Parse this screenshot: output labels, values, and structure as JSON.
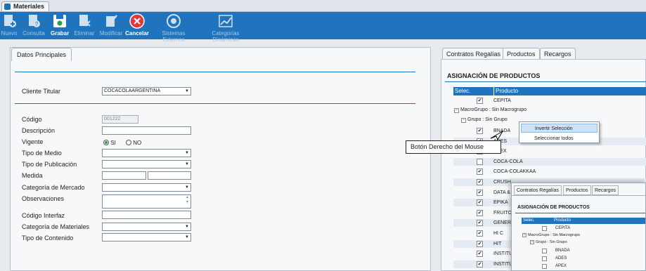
{
  "window": {
    "tab_title": "Materiales"
  },
  "toolbar": [
    {
      "label": "Nuevo",
      "icon": "new-doc-icon",
      "enabled": false
    },
    {
      "label": "Consulta",
      "icon": "query-doc-icon",
      "enabled": false
    },
    {
      "label": "Grabar",
      "icon": "save-icon",
      "enabled": true
    },
    {
      "label": "Eliminar",
      "icon": "delete-doc-icon",
      "enabled": false
    },
    {
      "label": "Modificar",
      "icon": "edit-doc-icon",
      "enabled": false
    },
    {
      "label": "Cancelar",
      "icon": "cancel-icon",
      "enabled": true
    },
    {
      "label": "Sistemas Externos",
      "icon": "external-systems-icon",
      "enabled": false
    },
    {
      "label": "Categorías Dinámicas",
      "icon": "chart-line-icon",
      "enabled": false
    }
  ],
  "left": {
    "tab": "Datos Principales",
    "cliente_label": "Cliente Titular",
    "cliente_value": "COCACOLAARGENTINA",
    "fields": {
      "codigo": {
        "label": "Código",
        "value": "001222"
      },
      "descripcion": {
        "label": "Descripción"
      },
      "vigente": {
        "label": "Vigente",
        "si": "SI",
        "no": "NO"
      },
      "tipo_medio": {
        "label": "Tipo de Medio"
      },
      "tipo_publicacion": {
        "label": "Tipo de Publicación"
      },
      "medida": {
        "label": "Medida"
      },
      "categoria_mercado": {
        "label": "Categoría de Mercado"
      },
      "observaciones": {
        "label": "Observaciones"
      },
      "codigo_interfaz": {
        "label": "Código Interfaz"
      },
      "categoria_materiales": {
        "label": "Categoría de Materiales"
      },
      "tipo_contenido": {
        "label": "Tipo de Contenido"
      }
    }
  },
  "right": {
    "tabs": [
      "Contratos Regalías",
      "Productos",
      "Recargos"
    ],
    "section_title": "ASIGNACIÓN DE PRODUCTOS",
    "col_selec": "Selec.",
    "col_producto": "Producto",
    "first_row": "CEPITA",
    "macro_group": "MacroGrupo : Sin Macrogrupo",
    "group": "Grupo : Sin Grupo",
    "rows": [
      {
        "name": "BNADA",
        "checked": true
      },
      {
        "name": "ADES",
        "checked": true
      },
      {
        "name": "APEX",
        "checked": false
      },
      {
        "name": "COCA-COLA",
        "checked": false
      },
      {
        "name": "COCA-COLAKKAA",
        "checked": true
      },
      {
        "name": "CRUSH",
        "checked": true
      },
      {
        "name": "DATA & A",
        "checked": true
      },
      {
        "name": "EPIKA",
        "checked": true
      },
      {
        "name": "FRUITOP",
        "checked": true
      },
      {
        "name": "GENERIC",
        "checked": true
      },
      {
        "name": "HI C",
        "checked": true
      },
      {
        "name": "HIT",
        "checked": true
      },
      {
        "name": "INSTITUT",
        "checked": true
      },
      {
        "name": "INSTITUT",
        "checked": true
      }
    ]
  },
  "context_menu": {
    "invert": "Invertir Selección",
    "select_all": "Seleccionar todos"
  },
  "tooltip": "Botón Derecho del Mouse",
  "inset": {
    "tabs": [
      "Contratos Regalías",
      "Productos",
      "Recargos"
    ],
    "section_title": "ASIGNACIÓN DE PRODUCTOS",
    "col_selec": "Selec.",
    "col_producto": "Producto",
    "first_row": "CEPITA",
    "macro_group": "MacroGrupo : Sin Macrogrupo",
    "group": "Grupo : Sin Grupo",
    "rows": [
      "BNADA",
      "ADES",
      "APEX"
    ]
  },
  "colors": {
    "toolbar_bg": "#1f74bd",
    "cancel_red": "#e2373c",
    "save_green": "#2e9b47"
  }
}
